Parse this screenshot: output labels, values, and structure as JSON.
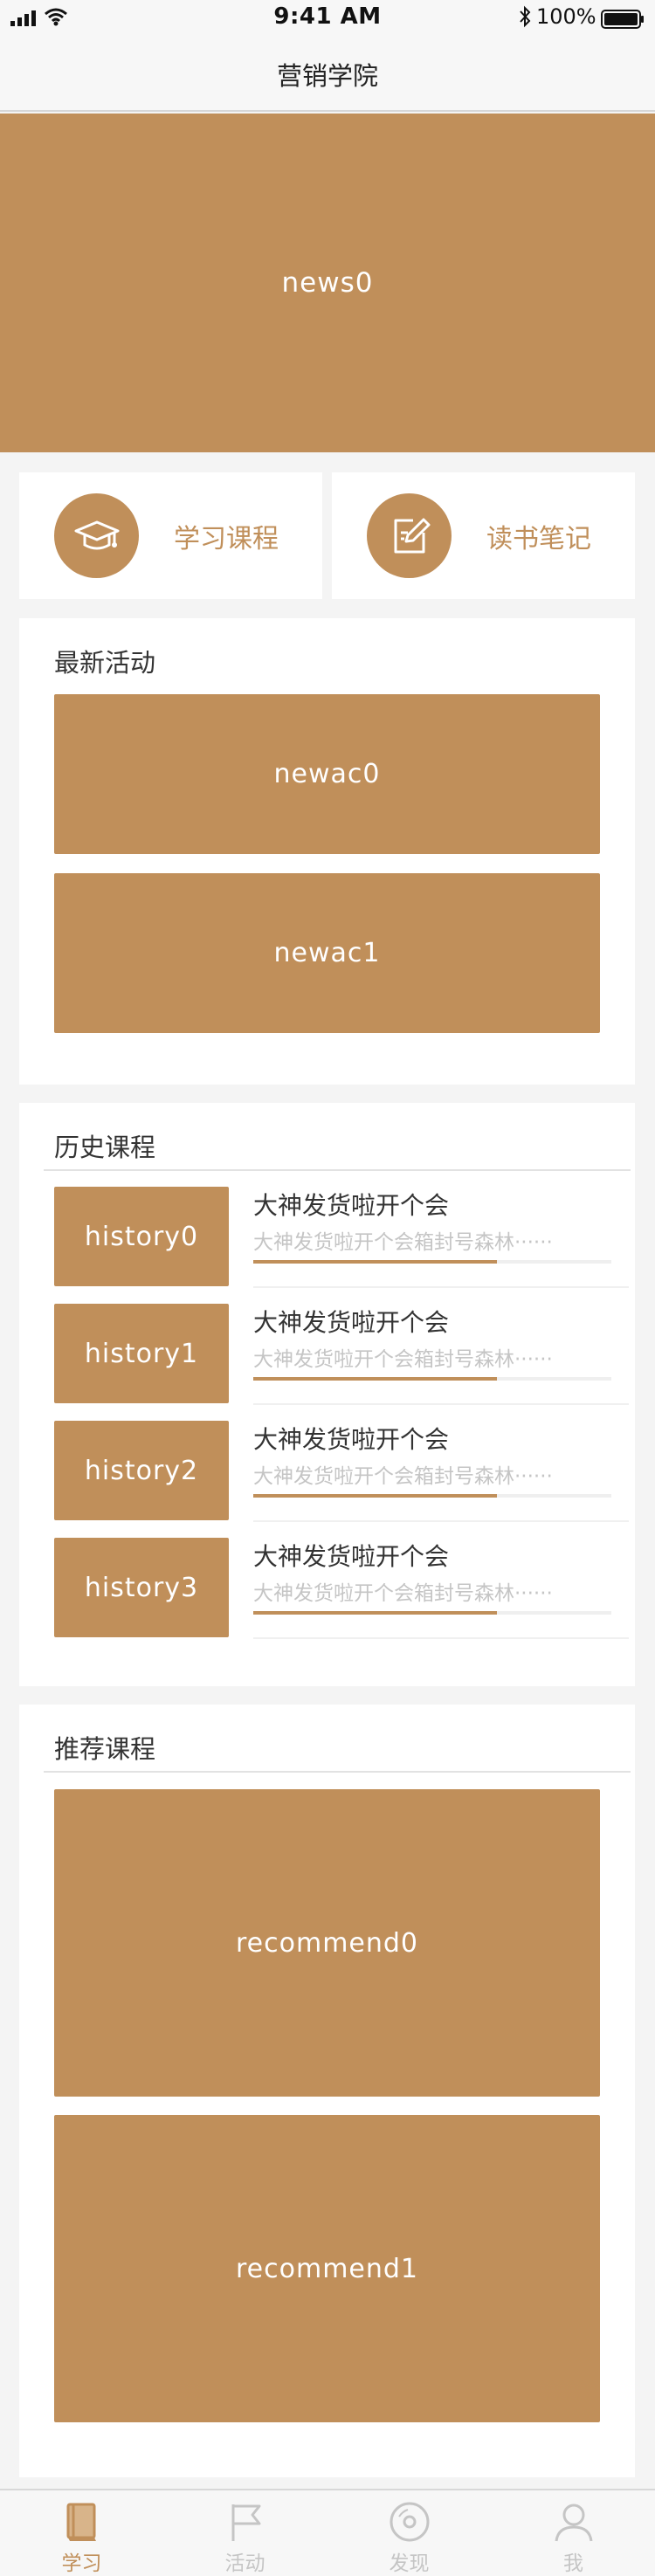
{
  "status_bar": {
    "time": "9:41 AM",
    "battery": "100%"
  },
  "nav": {
    "title": "营销学院"
  },
  "banner": {
    "label": "news0"
  },
  "quick_links": [
    {
      "label": "学习课程",
      "icon": "graduation-cap-icon"
    },
    {
      "label": "读书笔记",
      "icon": "note-edit-icon"
    }
  ],
  "latest_activities": {
    "title": "最新活动",
    "items": [
      "newac0",
      "newac1"
    ]
  },
  "history": {
    "title": "历史课程",
    "items": [
      {
        "thumb": "history0",
        "title": "大神发货啦开个会",
        "subtitle": "大神发货啦开个会箱封号森林······",
        "progress": 0.68
      },
      {
        "thumb": "history1",
        "title": "大神发货啦开个会",
        "subtitle": "大神发货啦开个会箱封号森林······",
        "progress": 0.68
      },
      {
        "thumb": "history2",
        "title": "大神发货啦开个会",
        "subtitle": "大神发货啦开个会箱封号森林······",
        "progress": 0.68
      },
      {
        "thumb": "history3",
        "title": "大神发货啦开个会",
        "subtitle": "大神发货啦开个会箱封号森林······",
        "progress": 0.68
      }
    ]
  },
  "recommend": {
    "title": "推荐课程",
    "items": [
      "recommend0",
      "recommend1"
    ]
  },
  "tab_bar": {
    "items": [
      {
        "label": "学习",
        "icon": "book-icon",
        "active": true
      },
      {
        "label": "活动",
        "icon": "flag-icon",
        "active": false
      },
      {
        "label": "发现",
        "icon": "disc-icon",
        "active": false
      },
      {
        "label": "我",
        "icon": "user-icon",
        "active": false
      }
    ]
  },
  "colors": {
    "accent": "#c08f5a",
    "background": "#f4f4f4",
    "muted": "#c5c5c5"
  }
}
